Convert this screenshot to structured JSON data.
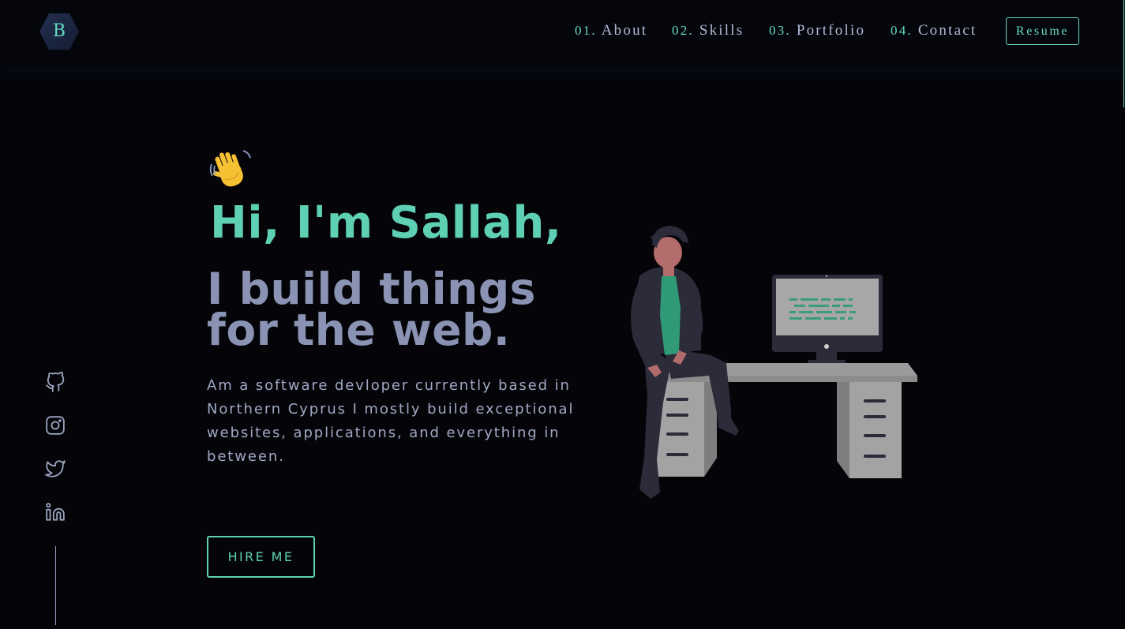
{
  "header": {
    "logo_letter": "B",
    "nav": [
      {
        "num": "01.",
        "label": "About"
      },
      {
        "num": "02.",
        "label": "Skills"
      },
      {
        "num": "03.",
        "label": "Portfolio"
      },
      {
        "num": "04.",
        "label": "Contact"
      }
    ],
    "resume_label": "Resume"
  },
  "hero": {
    "wave_emoji": "👋",
    "greeting": "Hi, I'm Sallah,",
    "headline": "I build things for the web.",
    "bio": "Am a software devloper currently based in Northern Cyprus I mostly build exceptional websites, applications, and everything in between.",
    "hire_label": "HIRE ME"
  },
  "socials": [
    {
      "icon": "github-icon"
    },
    {
      "icon": "instagram-icon"
    },
    {
      "icon": "twitter-icon"
    },
    {
      "icon": "linkedin-icon"
    }
  ],
  "colors": {
    "background": "#050509",
    "accent": "#64d8c0",
    "text_muted": "#8892b0"
  }
}
